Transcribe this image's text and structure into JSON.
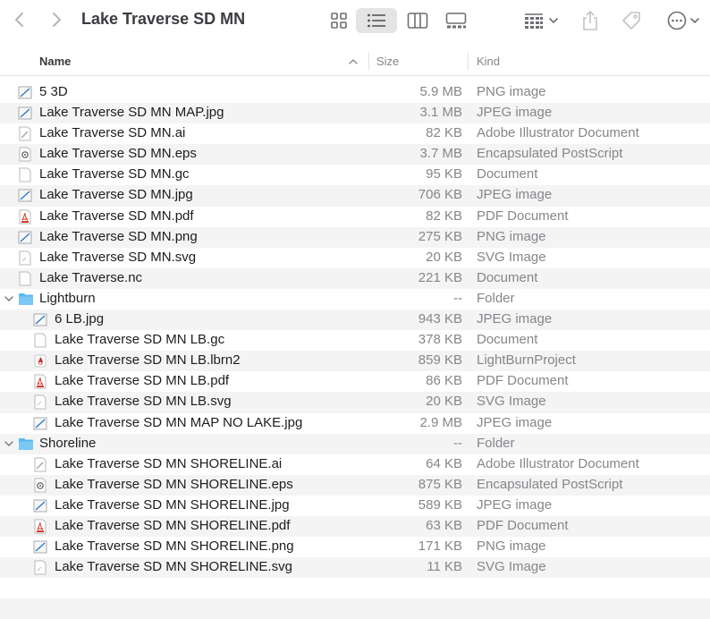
{
  "window": {
    "title": "Lake Traverse SD MN",
    "back_icon": "chevron-left-icon",
    "forward_icon": "chevron-right-icon"
  },
  "toolbar": {
    "icons": [
      "grid-view-icon",
      "list-view-icon",
      "column-view-icon",
      "gallery-view-icon",
      "group-icon",
      "share-icon",
      "tag-icon",
      "more-icon"
    ]
  },
  "columns": {
    "name": "Name",
    "size": "Size",
    "kind": "Kind"
  },
  "files": [
    {
      "name": "5 3D",
      "size": "5.9 MB",
      "kind": "PNG image",
      "icon": "image-icon",
      "depth": 0
    },
    {
      "name": "Lake Traverse SD MN MAP.jpg",
      "size": "3.1 MB",
      "kind": "JPEG image",
      "icon": "image-icon",
      "depth": 0
    },
    {
      "name": "Lake Traverse SD MN.ai",
      "size": "82 KB",
      "kind": "Adobe Illustrator Document",
      "icon": "ai-file-icon",
      "depth": 0
    },
    {
      "name": "Lake Traverse SD MN.eps",
      "size": "3.7 MB",
      "kind": "Encapsulated PostScript",
      "icon": "eps-file-icon",
      "depth": 0
    },
    {
      "name": "Lake Traverse SD MN.gc",
      "size": "95 KB",
      "kind": "Document",
      "icon": "document-icon",
      "depth": 0
    },
    {
      "name": "Lake Traverse SD MN.jpg",
      "size": "706 KB",
      "kind": "JPEG image",
      "icon": "image-icon",
      "depth": 0
    },
    {
      "name": "Lake Traverse SD MN.pdf",
      "size": "82 KB",
      "kind": "PDF Document",
      "icon": "pdf-file-icon",
      "depth": 0
    },
    {
      "name": "Lake Traverse SD MN.png",
      "size": "275 KB",
      "kind": "PNG image",
      "icon": "image-icon",
      "depth": 0
    },
    {
      "name": "Lake Traverse SD MN.svg",
      "size": "20 KB",
      "kind": "SVG Image",
      "icon": "svg-file-icon",
      "depth": 0
    },
    {
      "name": "Lake Traverse.nc",
      "size": "221 KB",
      "kind": "Document",
      "icon": "document-icon",
      "depth": 0
    },
    {
      "name": "Lightburn",
      "size": "--",
      "kind": "Folder",
      "icon": "folder-icon",
      "depth": 0,
      "folder": true
    },
    {
      "name": "6 LB.jpg",
      "size": "943 KB",
      "kind": "JPEG image",
      "icon": "image-icon",
      "depth": 1
    },
    {
      "name": "Lake Traverse SD MN LB.gc",
      "size": "378 KB",
      "kind": "Document",
      "icon": "document-icon",
      "depth": 1
    },
    {
      "name": "Lake Traverse SD MN LB.lbrn2",
      "size": "859 KB",
      "kind": "LightBurnProject",
      "icon": "lightburn-file-icon",
      "depth": 1
    },
    {
      "name": "Lake Traverse SD MN LB.pdf",
      "size": "86 KB",
      "kind": "PDF Document",
      "icon": "pdf-file-icon",
      "depth": 1
    },
    {
      "name": "Lake Traverse SD MN LB.svg",
      "size": "20 KB",
      "kind": "SVG Image",
      "icon": "svg-file-icon",
      "depth": 1
    },
    {
      "name": "Lake Traverse SD MN MAP NO LAKE.jpg",
      "size": "2.9 MB",
      "kind": "JPEG image",
      "icon": "image-icon",
      "depth": 1
    },
    {
      "name": "Shoreline",
      "size": "--",
      "kind": "Folder",
      "icon": "folder-icon",
      "depth": 0,
      "folder": true
    },
    {
      "name": "Lake Traverse SD MN SHORELINE.ai",
      "size": "64 KB",
      "kind": "Adobe Illustrator Document",
      "icon": "ai-file-icon",
      "depth": 1
    },
    {
      "name": "Lake Traverse SD MN SHORELINE.eps",
      "size": "875 KB",
      "kind": "Encapsulated PostScript",
      "icon": "eps-file-icon",
      "depth": 1
    },
    {
      "name": "Lake Traverse SD MN SHORELINE.jpg",
      "size": "589 KB",
      "kind": "JPEG image",
      "icon": "image-icon",
      "depth": 1
    },
    {
      "name": "Lake Traverse SD MN SHORELINE.pdf",
      "size": "63 KB",
      "kind": "PDF Document",
      "icon": "pdf-file-icon",
      "depth": 1
    },
    {
      "name": "Lake Traverse SD MN SHORELINE.png",
      "size": "171 KB",
      "kind": "PNG image",
      "icon": "image-icon",
      "depth": 1
    },
    {
      "name": "Lake Traverse SD MN SHORELINE.svg",
      "size": "11 KB",
      "kind": "SVG Image",
      "icon": "svg-file-icon",
      "depth": 1
    }
  ],
  "colors": {
    "folder": "#5ab8f0",
    "pdf": "#d83a2c",
    "row_alt": "#f4f4f5",
    "secondary_text": "#86868b"
  }
}
